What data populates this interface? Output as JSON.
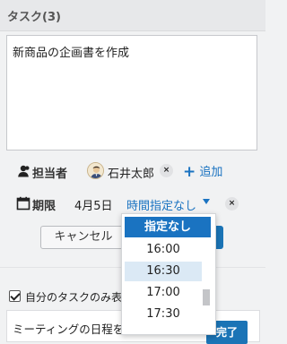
{
  "header": {
    "title": "タスク(3)"
  },
  "editor": {
    "task_text": "新商品の企画書を作成",
    "assignee_label": "担当者",
    "assignee_name": "石井太郎",
    "remove_symbol": "×",
    "add_plus": "+",
    "add_label": "追加",
    "due_label": "期限",
    "due_date": "4月5日",
    "time_value": "時間指定なし",
    "cancel_label": "キャンセル"
  },
  "time_dropdown": {
    "selected": "指定なし",
    "options": [
      "16:00",
      "16:30",
      "17:00",
      "17:30"
    ],
    "highlighted_index": 1
  },
  "filter": {
    "own_tasks_label": "自分のタスクのみ表"
  },
  "task_list": {
    "items": [
      {
        "text": "ミーティングの日程を決めて、会",
        "complete_label": "完了"
      }
    ]
  },
  "colors": {
    "accent": "#1a73c1",
    "primary_button": "#1b74b6",
    "hover_row": "#dbe9f5"
  }
}
